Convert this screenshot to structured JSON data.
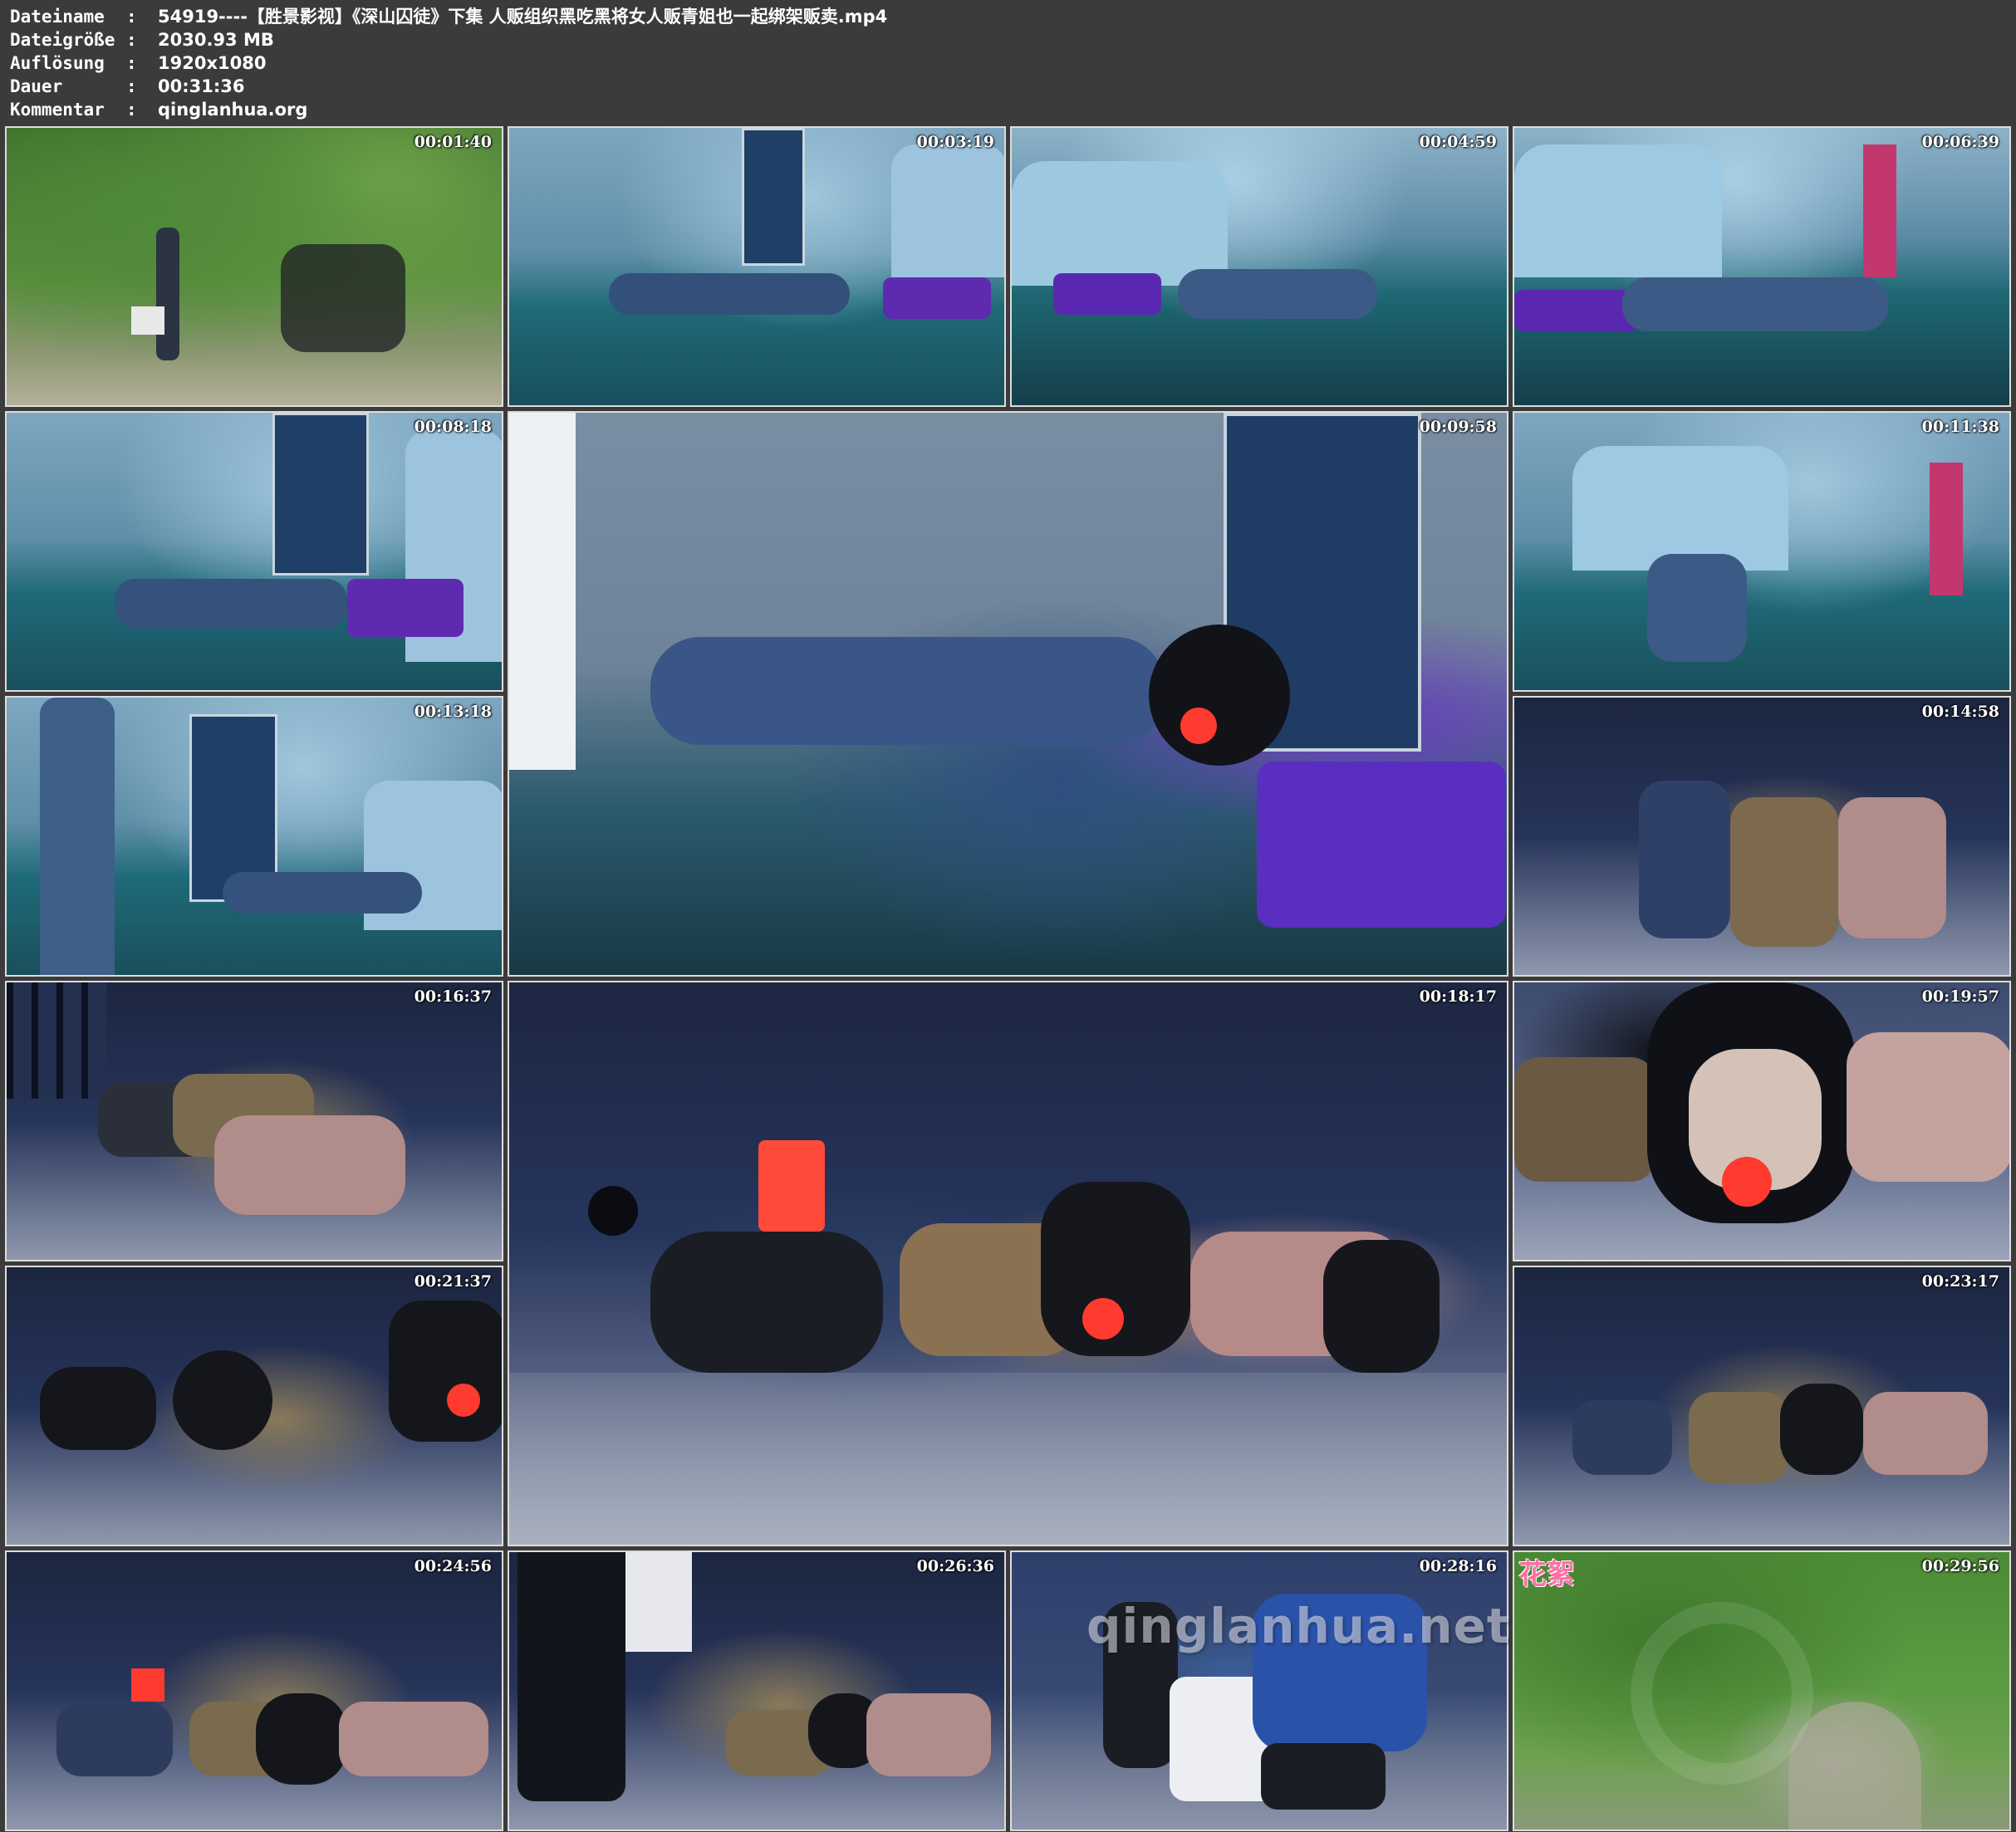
{
  "header": {
    "rows": [
      {
        "label": "Dateiname",
        "value": "54919----【胜景影视】《深山囚徒》下集 人贩组织黑吃黑将女人贩青姐也一起绑架贩卖.mp4"
      },
      {
        "label": "Dateigröße",
        "value": "2030.93 MB"
      },
      {
        "label": "Auflösung",
        "value": "1920x1080"
      },
      {
        "label": "Dauer",
        "value": "00:31:36"
      },
      {
        "label": "Kommentar",
        "value": "qinglanhua.org"
      }
    ],
    "separator": ":"
  },
  "thumbnails": [
    {
      "timestamp": "00:01:40",
      "scene": "forest"
    },
    {
      "timestamp": "00:03:19",
      "scene": "bedroom"
    },
    {
      "timestamp": "00:04:59",
      "scene": "bedroom"
    },
    {
      "timestamp": "00:06:39",
      "scene": "bedroom"
    },
    {
      "timestamp": "00:08:18",
      "scene": "bedroom"
    },
    {
      "timestamp": "00:09:58",
      "scene": "bedroom-closeup"
    },
    {
      "timestamp": "00:11:38",
      "scene": "bedroom"
    },
    {
      "timestamp": "00:13:18",
      "scene": "bedroom"
    },
    {
      "timestamp": "00:14:58",
      "scene": "cell"
    },
    {
      "timestamp": "00:16:37",
      "scene": "cell"
    },
    {
      "timestamp": "00:18:17",
      "scene": "cell-large"
    },
    {
      "timestamp": "00:19:57",
      "scene": "cell-closeup"
    },
    {
      "timestamp": "00:21:37",
      "scene": "cell"
    },
    {
      "timestamp": "00:23:17",
      "scene": "cell"
    },
    {
      "timestamp": "00:24:56",
      "scene": "cell"
    },
    {
      "timestamp": "00:26:36",
      "scene": "cell"
    },
    {
      "timestamp": "00:28:16",
      "scene": "room"
    },
    {
      "timestamp": "00:29:56",
      "scene": "forest-path"
    }
  ],
  "watermark": "qinglanhua.net",
  "corner_label": "花絮",
  "colors": {
    "background": "#3b3b3b",
    "header_text": "#ffffff",
    "thumb_border": "#dcdcdc",
    "watermark": "#ebebf5",
    "corner_label": "#ff6fa6"
  }
}
